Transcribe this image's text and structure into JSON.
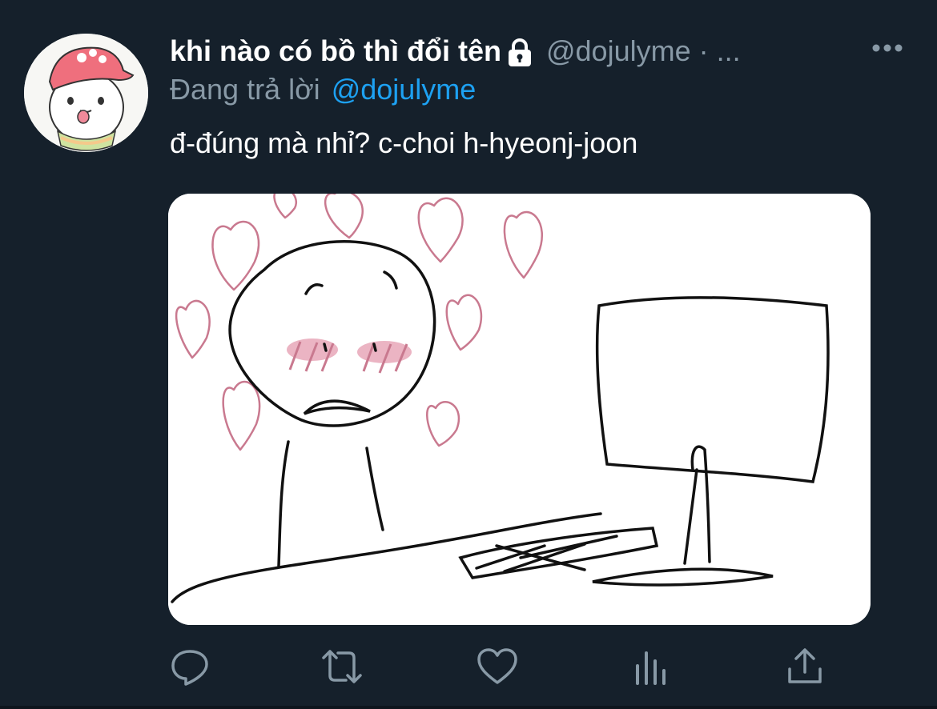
{
  "tweet": {
    "display_name": "khi nào có bồ thì đổi tên",
    "handle_meta": "@dojulyme · ...",
    "reply_prefix": "Đang trả lời",
    "reply_mention": "@dojulyme",
    "text": "đ-đúng mà nhỉ? c-choi h-hyeonj-joon"
  },
  "icons": {
    "lock": "lock-icon",
    "more": "more-icon",
    "reply": "reply-icon",
    "retweet": "retweet-icon",
    "like": "heart-icon",
    "analytics": "analytics-icon",
    "share": "share-icon"
  },
  "colors": {
    "background": "#15202b",
    "primary_text": "#ffffff",
    "secondary_text": "#8899a6",
    "accent": "#1da1f2",
    "media_hearts": "#c9798f"
  }
}
